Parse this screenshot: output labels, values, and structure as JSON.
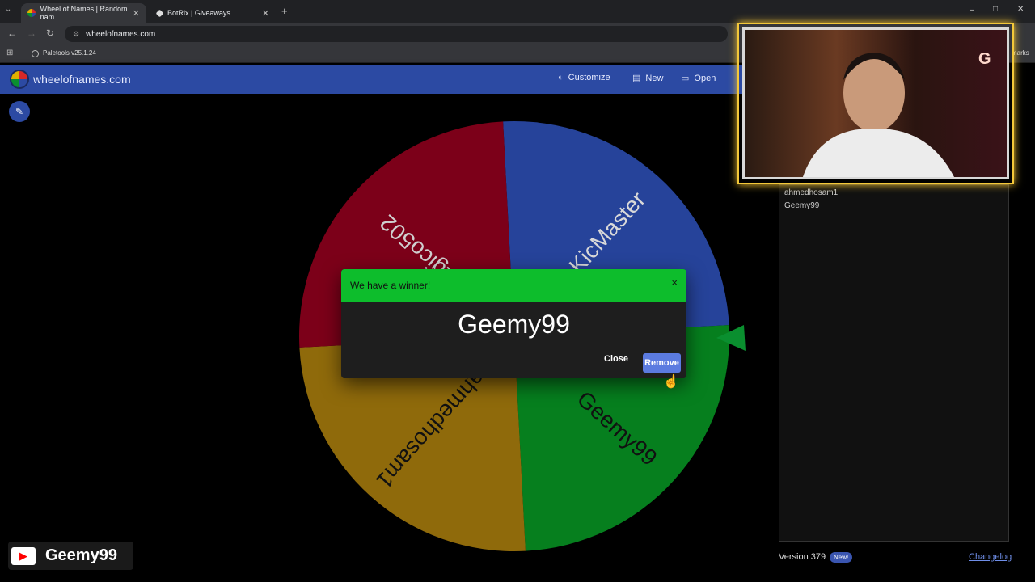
{
  "browser": {
    "tabs": [
      {
        "label": "Wheel of Names | Random nam",
        "active": true
      },
      {
        "label": "BotRix | Giveaways",
        "active": false
      }
    ],
    "new_tab": "+",
    "url": "wheelofnames.com",
    "bookmark": "Paletools v25.1.24",
    "bookmarks_tail": "marks",
    "window_controls": [
      "–",
      "□",
      "✕"
    ]
  },
  "app": {
    "title": "wheelofnames.com",
    "menu": [
      {
        "label": "Customize",
        "icon": "palette-icon"
      },
      {
        "label": "New",
        "icon": "file-icon"
      },
      {
        "label": "Open",
        "icon": "folder-icon"
      }
    ]
  },
  "wheel": {
    "segments": [
      {
        "name": "KicMaster",
        "color": "#26439a"
      },
      {
        "name": "Geemy99",
        "color": "#067f1e"
      },
      {
        "name": "ahmedhosam1",
        "color": "#8f6a0b"
      },
      {
        "name": "Magico502",
        "color": "#7c0019"
      }
    ],
    "pointer_color": "#0a8f2f"
  },
  "modal": {
    "title": "We have a winner!",
    "close_x": "×",
    "winner": "Geemy99",
    "close_label": "Close",
    "remove_label": "Remove",
    "header_color": "#0dbd2c"
  },
  "panel": {
    "entries": [
      "ahmedhosam1",
      "Geemy99"
    ],
    "version": "Version 379",
    "new_badge": "New!",
    "changelog": "Changelog"
  },
  "overlay": {
    "cam_badge": "G",
    "channel": "Geemy99"
  }
}
